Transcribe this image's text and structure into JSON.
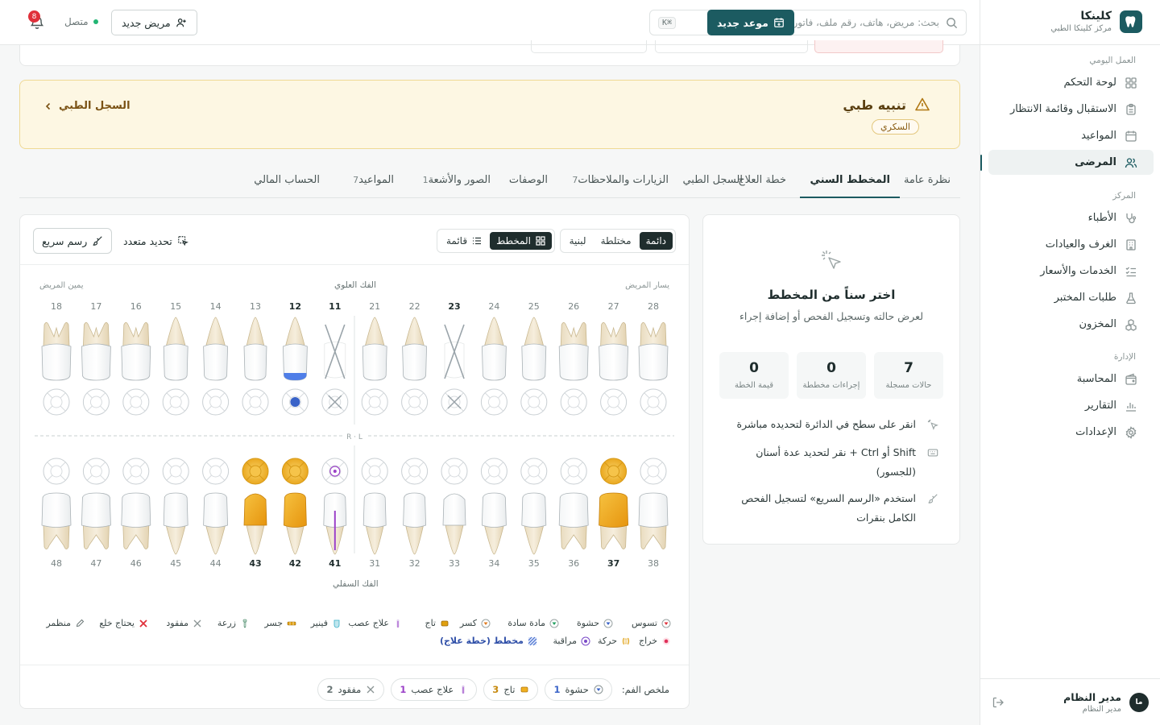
{
  "brand": {
    "name": "كلينكا",
    "subtitle": "مركز كلينكا الطبي"
  },
  "sidebar": {
    "groups": [
      {
        "title": "العمل اليومي",
        "items": [
          {
            "label": "لوحة التحكم",
            "icon": "dashboard-icon"
          },
          {
            "label": "الاستقبال وقائمة الانتظار",
            "icon": "clipboard-icon"
          },
          {
            "label": "المواعيد",
            "icon": "calendar-icon"
          },
          {
            "label": "المرضى",
            "icon": "users-icon",
            "active": true
          }
        ]
      },
      {
        "title": "المركز",
        "items": [
          {
            "label": "الأطباء",
            "icon": "stethoscope-icon"
          },
          {
            "label": "الغرف والعيادات",
            "icon": "building-icon"
          },
          {
            "label": "الخدمات والأسعار",
            "icon": "list-check-icon"
          },
          {
            "label": "طلبات المختبر",
            "icon": "flask-icon"
          },
          {
            "label": "المخزون",
            "icon": "boxes-icon"
          }
        ]
      },
      {
        "title": "الإدارة",
        "items": [
          {
            "label": "المحاسبة",
            "icon": "wallet-icon"
          },
          {
            "label": "التقارير",
            "icon": "bar-chart-icon"
          },
          {
            "label": "الإعدادات",
            "icon": "gear-icon"
          }
        ]
      }
    ],
    "user": {
      "initials": "ما",
      "name": "مدير النظام",
      "role": "مدير النظام"
    }
  },
  "topbar": {
    "search_placeholder": "بحث: مريض، هاتف، رقم ملف، فاتورة",
    "search_shortcut": "⌘K",
    "new_appointment": "موعد جديد",
    "new_patient": "مريض جديد",
    "status": "متصل",
    "notifications": "8"
  },
  "alert": {
    "title": "تنبيه طبي",
    "chip": "السكري",
    "link": "السجل الطبي"
  },
  "tabs": [
    {
      "label": "نظرة عامة"
    },
    {
      "label": "المخطط السني",
      "active": true
    },
    {
      "label": "خطة العلاج"
    },
    {
      "label": "السجل الطبي"
    },
    {
      "label": "الزيارات والملاحظات",
      "count": "7"
    },
    {
      "label": "الوصفات"
    },
    {
      "label": "الصور والأشعة",
      "count": "1"
    },
    {
      "label": "المواعيد",
      "count": "7"
    },
    {
      "label": "الحساب المالي"
    }
  ],
  "chart": {
    "dentition": {
      "permanent": "دائمة",
      "mixed": "مختلطة",
      "primary": "لبنية"
    },
    "view": {
      "chart": "المخطط",
      "list": "قائمة"
    },
    "multi_select": "تحديد متعدد",
    "quick_draw": "رسم سريع",
    "upper_jaw": "الفك العلوي",
    "lower_jaw": "الفك السفلي",
    "patient_right": "يمين المريض",
    "patient_left": "يسار المريض",
    "midline": "R · L",
    "upper_teeth": [
      "18",
      "17",
      "16",
      "15",
      "14",
      "13",
      "12",
      "11",
      "21",
      "22",
      "23",
      "24",
      "25",
      "26",
      "27",
      "28"
    ],
    "lower_teeth": [
      "48",
      "47",
      "46",
      "45",
      "44",
      "43",
      "42",
      "41",
      "31",
      "32",
      "33",
      "34",
      "35",
      "36",
      "37",
      "38"
    ]
  },
  "legend": [
    {
      "label": "تسوس",
      "icon": "caries-icon",
      "color": "#e0303a"
    },
    {
      "label": "حشوة",
      "icon": "filling-icon",
      "color": "#3a63c8"
    },
    {
      "label": "مادة سادة",
      "icon": "sealant-icon",
      "color": "#22a060"
    },
    {
      "label": "كسر",
      "icon": "fracture-icon",
      "color": "#e07b20"
    },
    {
      "label": "تاج",
      "icon": "crown-icon",
      "color": "#e0a010"
    },
    {
      "label": "علاج عصب",
      "icon": "root-canal-icon",
      "color": "#9b40c8"
    },
    {
      "label": "فينير",
      "icon": "veneer-icon",
      "color": "#3ab0c8"
    },
    {
      "label": "جسر",
      "icon": "bridge-icon",
      "color": "#e0a010"
    },
    {
      "label": "زرعة",
      "icon": "implant-icon",
      "color": "#4a8a6a"
    },
    {
      "label": "مفقود",
      "icon": "missing-icon",
      "color": "#8a9494"
    },
    {
      "label": "يحتاج خلع",
      "icon": "extraction-icon",
      "color": "#e0303a"
    },
    {
      "label": "منظمر",
      "icon": "sensitive-icon",
      "color": "#6a7676"
    },
    {
      "label": "خراج",
      "icon": "abscess-icon",
      "color": "#e0305a"
    },
    {
      "label": "حركة",
      "icon": "mobility-icon",
      "color": "#e0a010"
    },
    {
      "label": "مراقبة",
      "icon": "watch-icon",
      "color": "#7a4ac8"
    },
    {
      "label": "مخطط (خطة علاج)",
      "icon": "planned-icon",
      "color": "#3a63c8"
    }
  ],
  "summary": {
    "label": "ملخص الفم:",
    "items": [
      {
        "label": "حشوة",
        "count": "1",
        "icon": "filling-icon"
      },
      {
        "label": "تاج",
        "count": "3",
        "icon": "crown-icon"
      },
      {
        "label": "علاج عصب",
        "count": "1",
        "icon": "root-canal-icon"
      },
      {
        "label": "مفقود",
        "count": "2",
        "icon": "missing-icon"
      }
    ]
  },
  "info": {
    "title": "اختر سناً من المخطط",
    "subtitle": "لعرض حالته وتسجيل الفحص أو إضافة إجراء",
    "stats": [
      {
        "value": "7",
        "label": "حالات مسجلة"
      },
      {
        "value": "0",
        "label": "إجراءات مخططة"
      },
      {
        "value": "0",
        "label": "قيمة الخطة"
      }
    ],
    "tips": [
      "انقر على سطح في الدائرة لتحديده مباشرة",
      "Shift أو Ctrl + نقر لتحديد عدة أسنان (للجسور)",
      "استخدم «الرسم السريع» لتسجيل الفحص الكامل بنقرات"
    ]
  }
}
